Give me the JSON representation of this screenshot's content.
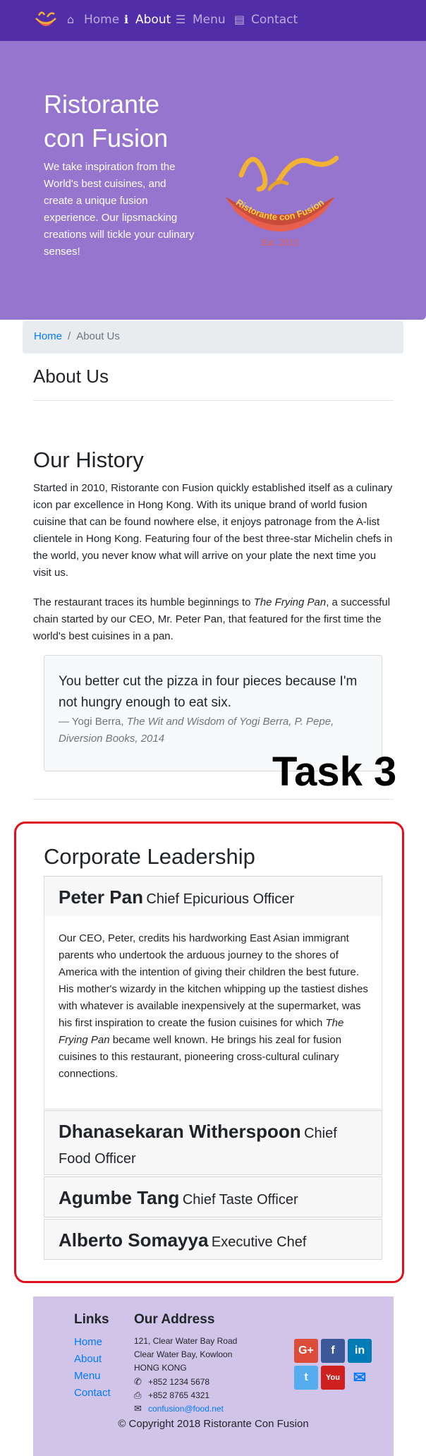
{
  "nav": {
    "items": [
      {
        "label": "Home",
        "icon": "home-icon"
      },
      {
        "label": "About",
        "icon": "info-icon"
      },
      {
        "label": "Menu",
        "icon": "list-icon"
      },
      {
        "label": "Contact",
        "icon": "address-card-icon"
      }
    ],
    "active": "About"
  },
  "jumbotron": {
    "title": "Ristorante con Fusion",
    "text": "We take inspiration from the World's best cuisines, and create a unique fusion experience. Our lipsmacking creations will tickle your culinary senses!",
    "logo_text": "Ristorante con Fusion",
    "logo_est": "Est. 2013"
  },
  "breadcrumb": {
    "home": "Home",
    "separator": "/",
    "current": "About Us"
  },
  "about": {
    "heading": "About Us",
    "history_heading": "Our History",
    "para1": "Started in 2010, Ristorante con Fusion quickly established itself as a culinary icon par excellence in Hong Kong. With its unique brand of world fusion cuisine that can be found nowhere else, it enjoys patronage from the A-list clientele in Hong Kong. Featuring four of the best three-star Michelin chefs in the world, you never know what will arrive on your plate the next time you visit us.",
    "para2_a": "The restaurant traces its humble beginnings to ",
    "para2_em": "The Frying Pan",
    "para2_b": ", a successful chain started by our CEO, Mr. Peter Pan, that featured for the first time the world's best cuisines in a pan."
  },
  "quote": {
    "text": "You better cut the pizza in four pieces because I'm not hungry enough to eat six.",
    "author": "— Yogi Berra, ",
    "source": "The Wit and Wisdom of Yogi Berra, P. Pepe, Diversion Books, 2014"
  },
  "annotation": "Task 3",
  "leadership": {
    "heading": "Corporate Leadership",
    "leaders": [
      {
        "name": "Peter Pan",
        "role": "Chief Epicurious Officer"
      },
      {
        "name": "Dhanasekaran Witherspoon",
        "role": "Chief Food Officer"
      },
      {
        "name": "Agumbe Tang",
        "role": "Chief Taste Officer"
      },
      {
        "name": "Alberto Somayya",
        "role": "Executive Chef"
      }
    ],
    "bio_a": "Our CEO, Peter, credits his hardworking East Asian immigrant parents who undertook the arduous journey to the shores of America with the intention of giving their children the best future. His mother's wizardy in the kitchen whipping up the tastiest dishes with whatever is available inexpensively at the supermarket, was his first inspiration to create the fusion cuisines for which ",
    "bio_em": "The Frying Pan",
    "bio_b": " became well known. He brings his zeal for fusion cuisines to this restaurant, pioneering cross-cultural culinary connections."
  },
  "footer": {
    "links_heading": "Links",
    "links": [
      "Home",
      "About",
      "Menu",
      "Contact"
    ],
    "address_heading": "Our Address",
    "address": [
      "121, Clear Water Bay Road",
      "Clear Water Bay, Kowloon",
      "HONG KONG"
    ],
    "phone": "+852 1234 5678",
    "fax": "+852 8765 4321",
    "email": "confusion@food.net",
    "copyright": "© Copyright 2018 Ristorante Con Fusion",
    "social": [
      {
        "icon": "google-plus-icon",
        "glyph": "G+",
        "color": "#dd4b39"
      },
      {
        "icon": "facebook-icon",
        "glyph": "f",
        "color": "#3b5998"
      },
      {
        "icon": "linkedin-icon",
        "glyph": "in",
        "color": "#007bb6"
      },
      {
        "icon": "twitter-icon",
        "glyph": "t",
        "color": "#55acee"
      },
      {
        "icon": "youtube-icon",
        "glyph": "You",
        "color": "#cd201f"
      },
      {
        "icon": "mail-icon",
        "glyph": "✉",
        "color": "#007bff"
      }
    ]
  },
  "colors": {
    "primary": "#512DA8",
    "jumbotron": "#9575CD",
    "footer": "#D1C4E9",
    "annotation_box": "#e0111f"
  }
}
